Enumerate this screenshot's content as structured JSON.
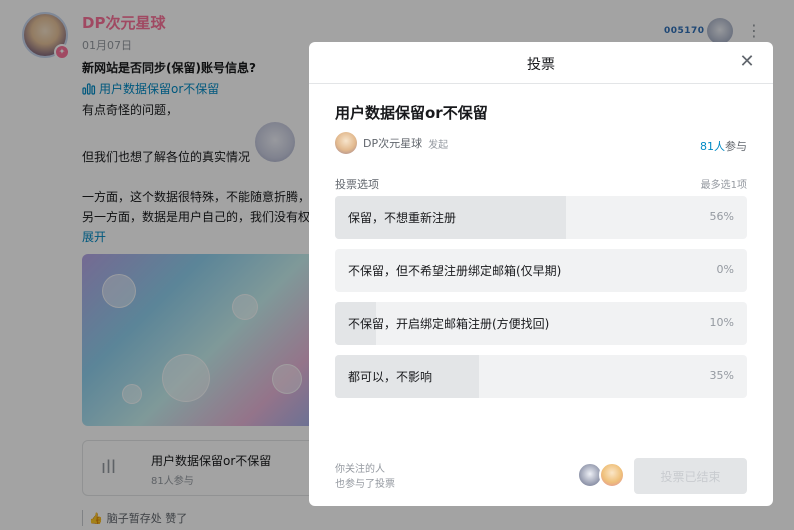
{
  "post": {
    "author": "DP次元星球",
    "date": "01月07日",
    "title": "新网站是否同步(保留)账号信息?",
    "poll_link": "用户数据保留or不保留",
    "lines": [
      "有点奇怪的问题，",
      "但我们也想了解各位的真实情况",
      "一方面，这个数据很特殊，不能随意折腾，",
      "另一方面，数据是用户自己的，我们没有权"
    ],
    "expand": "展开",
    "poll_card": {
      "title": "用户数据保留or不保留",
      "count": "81人参与"
    },
    "footer": "脑子暂存处 赞了",
    "top_right_badge": "005170"
  },
  "modal": {
    "title": "投票",
    "poll_title": "用户数据保留or不保留",
    "initiator_name": "DP次元星球",
    "initiator_action": "发起",
    "participant_count": "81人",
    "participant_suffix": "参与",
    "options_label": "投票选项",
    "max_choice": "最多选1项",
    "options": [
      {
        "label": "保留，不想重新注册",
        "percent": "56%",
        "value": 0.56
      },
      {
        "label": "不保留，但不希望注册绑定邮箱(仅早期)",
        "percent": "0%",
        "value": 0.0
      },
      {
        "label": "不保留，开启绑定邮箱注册(方便找回)",
        "percent": "10%",
        "value": 0.1
      },
      {
        "label": "都可以，不影响",
        "percent": "35%",
        "value": 0.35
      }
    ],
    "follow_note_line1": "你关注的人",
    "follow_note_line2": "也参与了投票",
    "ended_button": "投票已结束"
  },
  "colors": {
    "author_pink": "#fb7299",
    "link_blue": "#008ac5",
    "option_bg": "#f1f2f3",
    "option_fill": "#e3e5e7"
  }
}
